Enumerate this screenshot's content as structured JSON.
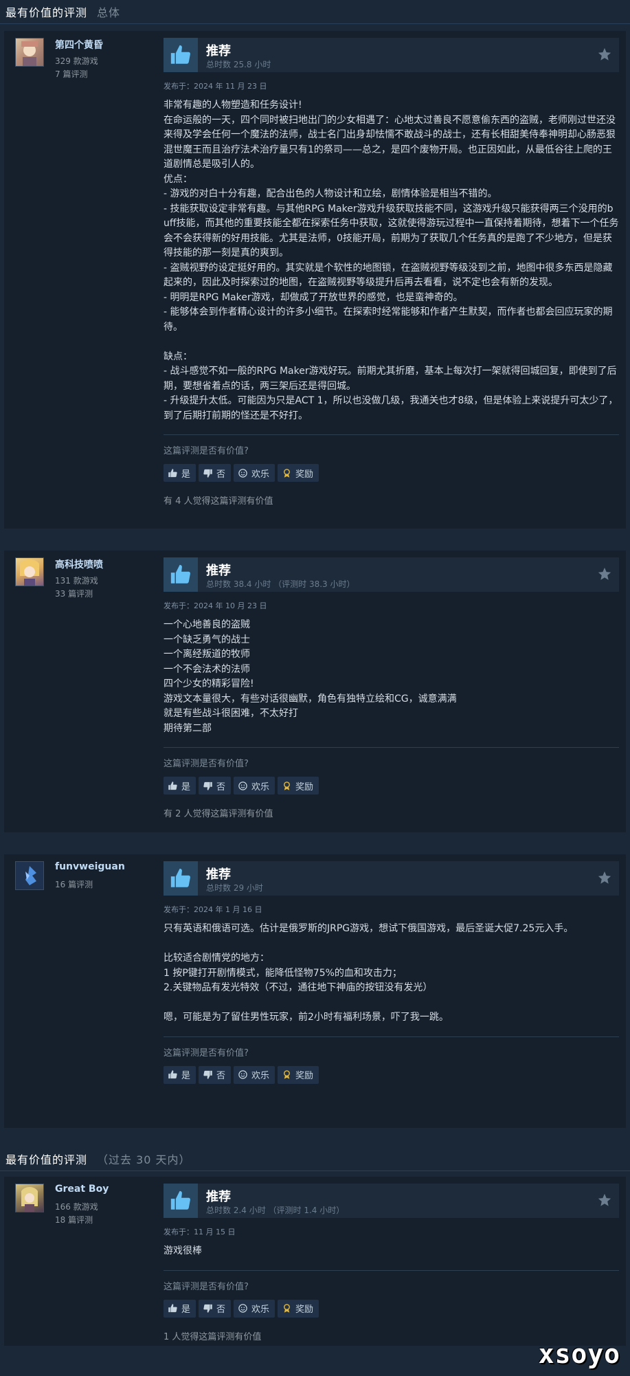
{
  "section1": {
    "title": "最有价值的评测",
    "subtitle": "总体"
  },
  "section2": {
    "title": "最有价值的评测",
    "subtitle": "（过去 30 天内）"
  },
  "labels": {
    "recommended": "推荐",
    "helpful_question": "这篇评测是否有价值?",
    "yes": "是",
    "no": "否",
    "funny": "欢乐",
    "award": "奖励"
  },
  "reviews": [
    {
      "author": "第四个黄昏",
      "games": "329 款游戏",
      "review_count": "7 篇评测",
      "hours": "总时数 25.8 小时",
      "posted": "发布于：2024 年 11 月 23 日",
      "content": "非常有趣的人物塑造和任务设计!\n在命运般的一天，四个同时被扫地出门的少女相遇了：心地太过善良不愿意偷东西的盗贼，老师刚过世还没来得及学会任何一个魔法的法师，战士名门出身却怯懦不敢战斗的战士，还有长相甜美侍奉神明却心肠恶狠混世魔王而且治疗法术治疗量只有1的祭司——总之，是四个废物开局。也正因如此，从最低谷往上爬的王道剧情总是吸引人的。\n优点：\n- 游戏的对白十分有趣，配合出色的人物设计和立绘，剧情体验是相当不错的。\n- 技能获取设定非常有趣。与其他RPG Maker游戏升级获取技能不同，这游戏升级只能获得两三个没用的buff技能，而其他的重要技能全都在探索任务中获取，这就使得游玩过程中一直保持着期待，想着下一个任务会不会获得新的好用技能。尤其是法师，0技能开局，前期为了获取几个任务真的是跑了不少地方，但是获得技能的那一刻是真的爽到。\n- 盗贼视野的设定挺好用的。其实就是个软性的地图锁，在盗贼视野等级没到之前，地图中很多东西是隐藏起来的，因此及时探索过的地图，在盗贼视野等级提升后再去看看，说不定也会有新的发现。\n- 明明是RPG Maker游戏，却做成了开放世界的感觉，也是蛮神奇的。\n- 能够体会到作者精心设计的许多小细节。在探索时经常能够和作者产生默契，而作者也都会回应玩家的期待。\n\n缺点：\n- 战斗感觉不如一般的RPG Maker游戏好玩。前期尤其折磨，基本上每次打一架就得回城回复，即使到了后期，要想省着点的话，两三架后还是得回城。\n- 升级提升太低。可能因为只是ACT 1，所以也没做几级，我通关也才8级，但是体验上来说提升可太少了，到了后期打前期的怪还是不好打。",
      "helpful": "有 4 人觉得这篇评测有价值"
    },
    {
      "author": "高科技喷喷",
      "games": "131 款游戏",
      "review_count": "33 篇评测",
      "hours": "总时数 38.4 小时 （评测时 38.3 小时）",
      "posted": "发布于：2024 年 10 月 23 日",
      "content": "一个心地善良的盗贼\n一个缺乏勇气的战士\n一个离经叛道的牧师\n一个不会法术的法师\n四个少女的精彩冒险!\n游戏文本量很大，有些对话很幽默，角色有独特立绘和CG，诚意满满\n就是有些战斗很困难，不太好打\n期待第二部",
      "helpful": "有 2 人觉得这篇评测有价值"
    },
    {
      "author": "funvweiguan",
      "games": "",
      "review_count": "16 篇评测",
      "hours": "总时数 29 小时",
      "posted": "发布于：2024 年 1 月 16 日",
      "content": "只有英语和俄语可选。估计是俄罗斯的JRPG游戏，想试下俄国游戏，最后圣诞大促7.25元入手。\n\n比较适合剧情党的地方：\n1 按P键打开剧情模式，能降低怪物75%的血和攻击力；\n2.关键物品有发光特效（不过，通往地下神庙的按钮没有发光）\n\n嗯，可能是为了留住男性玩家，前2小时有福利场景，吓了我一跳。",
      "helpful": ""
    },
    {
      "author": "Great Boy",
      "games": "166 款游戏",
      "review_count": "18 篇评测",
      "hours": "总时数 2.4 小时 （评测时 1.4 小时）",
      "posted": "发布于：11 月 15 日",
      "content": "游戏很棒",
      "helpful": "1 人觉得这篇评测有价值"
    }
  ],
  "watermark": "xsoyo"
}
